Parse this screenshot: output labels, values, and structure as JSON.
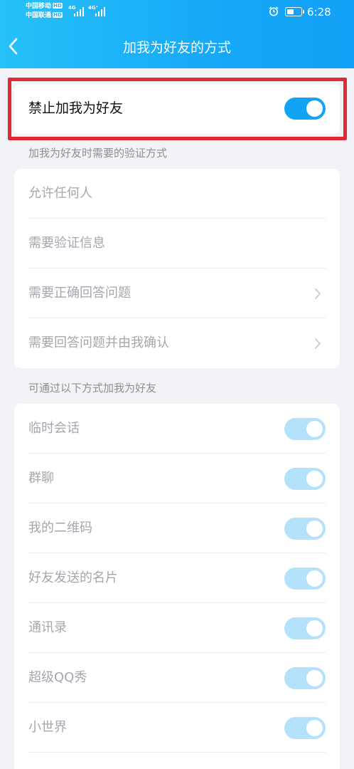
{
  "status": {
    "carrier1": "中国移动",
    "carrier2": "中国联通",
    "hd_badge": "HD",
    "net1": "4G",
    "net2": "4G⁺",
    "time": "6:28"
  },
  "header": {
    "title": "加我为好友的方式",
    "back_icon": "chevron-left-icon"
  },
  "primary": {
    "label": "禁止加我为好友",
    "enabled": true
  },
  "verify_section": {
    "title": "加我为好友时需要的验证方式",
    "items": [
      {
        "label": "允许任何人"
      },
      {
        "label": "需要验证信息"
      },
      {
        "label": "需要正确回答问题",
        "chevron": true
      },
      {
        "label": "需要回答问题并由我确认",
        "chevron": true
      }
    ]
  },
  "source_section": {
    "title": "可通过以下方式加我为好友",
    "items": [
      {
        "label": "临时会话",
        "on": true
      },
      {
        "label": "群聊",
        "on": true
      },
      {
        "label": "我的二维码",
        "on": true
      },
      {
        "label": "好友发送的名片",
        "on": true
      },
      {
        "label": "通讯录",
        "on": true
      },
      {
        "label": "超级QQ秀",
        "on": true
      },
      {
        "label": "小世界",
        "on": true
      }
    ]
  },
  "colors": {
    "accent": "#12a3f5",
    "toggle_disabled": "#b5e2fb",
    "highlight": "#e02a35"
  }
}
